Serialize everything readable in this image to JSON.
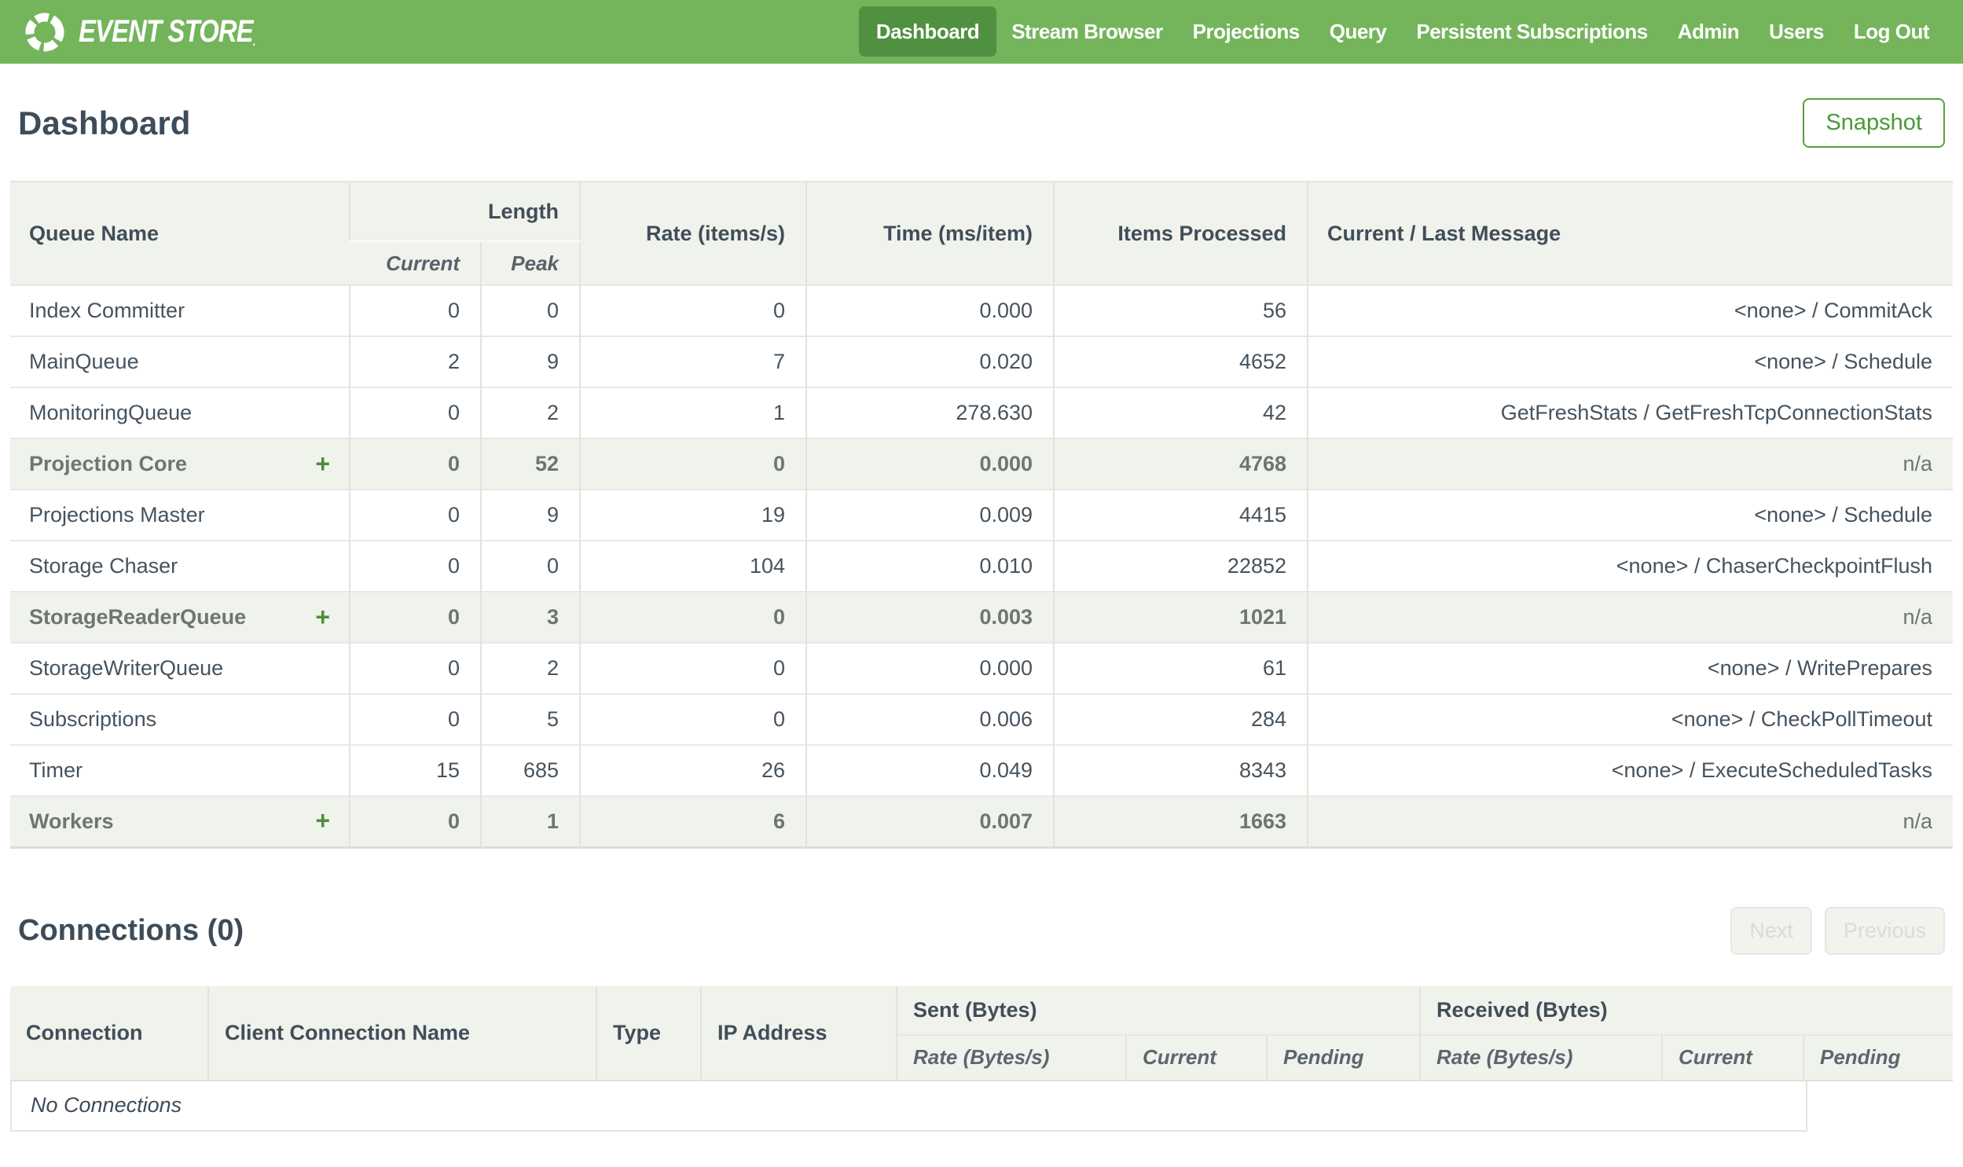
{
  "nav": {
    "brand": "EVENT STORE",
    "brand_mark": ".",
    "items": [
      {
        "label": "Dashboard",
        "active": true
      },
      {
        "label": "Stream Browser",
        "active": false
      },
      {
        "label": "Projections",
        "active": false
      },
      {
        "label": "Query",
        "active": false
      },
      {
        "label": "Persistent Subscriptions",
        "active": false
      },
      {
        "label": "Admin",
        "active": false
      },
      {
        "label": "Users",
        "active": false
      },
      {
        "label": "Log Out",
        "active": false
      }
    ]
  },
  "page": {
    "title": "Dashboard",
    "snapshot_button": "Snapshot"
  },
  "icons": {
    "expand": "+"
  },
  "queues_table": {
    "headers": {
      "queue_name": "Queue Name",
      "length": "Length",
      "current": "Current",
      "peak": "Peak",
      "rate": "Rate (items/s)",
      "time": "Time (ms/item)",
      "items_processed": "Items Processed",
      "message": "Current / Last Message"
    },
    "rows": [
      {
        "name": "Index Committer",
        "group": false,
        "current": "0",
        "peak": "0",
        "rate": "0",
        "time": "0.000",
        "items": "56",
        "message": "<none> / CommitAck"
      },
      {
        "name": "MainQueue",
        "group": false,
        "current": "2",
        "peak": "9",
        "rate": "7",
        "time": "0.020",
        "items": "4652",
        "message": "<none> / Schedule"
      },
      {
        "name": "MonitoringQueue",
        "group": false,
        "current": "0",
        "peak": "2",
        "rate": "1",
        "time": "278.630",
        "items": "42",
        "message": "GetFreshStats / GetFreshTcpConnectionStats"
      },
      {
        "name": "Projection Core",
        "group": true,
        "current": "0",
        "peak": "52",
        "rate": "0",
        "time": "0.000",
        "items": "4768",
        "message": "n/a"
      },
      {
        "name": "Projections Master",
        "group": false,
        "current": "0",
        "peak": "9",
        "rate": "19",
        "time": "0.009",
        "items": "4415",
        "message": "<none> / Schedule"
      },
      {
        "name": "Storage Chaser",
        "group": false,
        "current": "0",
        "peak": "0",
        "rate": "104",
        "time": "0.010",
        "items": "22852",
        "message": "<none> / ChaserCheckpointFlush"
      },
      {
        "name": "StorageReaderQueue",
        "group": true,
        "current": "0",
        "peak": "3",
        "rate": "0",
        "time": "0.003",
        "items": "1021",
        "message": "n/a"
      },
      {
        "name": "StorageWriterQueue",
        "group": false,
        "current": "0",
        "peak": "2",
        "rate": "0",
        "time": "0.000",
        "items": "61",
        "message": "<none> / WritePrepares"
      },
      {
        "name": "Subscriptions",
        "group": false,
        "current": "0",
        "peak": "5",
        "rate": "0",
        "time": "0.006",
        "items": "284",
        "message": "<none> / CheckPollTimeout"
      },
      {
        "name": "Timer",
        "group": false,
        "current": "15",
        "peak": "685",
        "rate": "26",
        "time": "0.049",
        "items": "8343",
        "message": "<none> / ExecuteScheduledTasks"
      },
      {
        "name": "Workers",
        "group": true,
        "current": "0",
        "peak": "1",
        "rate": "6",
        "time": "0.007",
        "items": "1663",
        "message": "n/a"
      }
    ]
  },
  "connections": {
    "title": "Connections (0)",
    "next_button": "Next",
    "previous_button": "Previous",
    "headers": {
      "connection": "Connection",
      "client_connection_name": "Client Connection Name",
      "type": "Type",
      "ip_address": "IP Address",
      "sent": "Sent (Bytes)",
      "received": "Received (Bytes)",
      "rate": "Rate (Bytes/s)",
      "current": "Current",
      "pending": "Pending"
    },
    "empty_message": "No Connections"
  },
  "colors": {
    "nav_green": "#74b55c",
    "nav_active_green": "#4f9140",
    "accent_green": "#4a9a35",
    "heading_text": "#3e4c59",
    "table_header_bg": "#f0f2ec",
    "group_row_bg": "#f0f2ec",
    "disabled_button_text": "#d9dcd3"
  }
}
